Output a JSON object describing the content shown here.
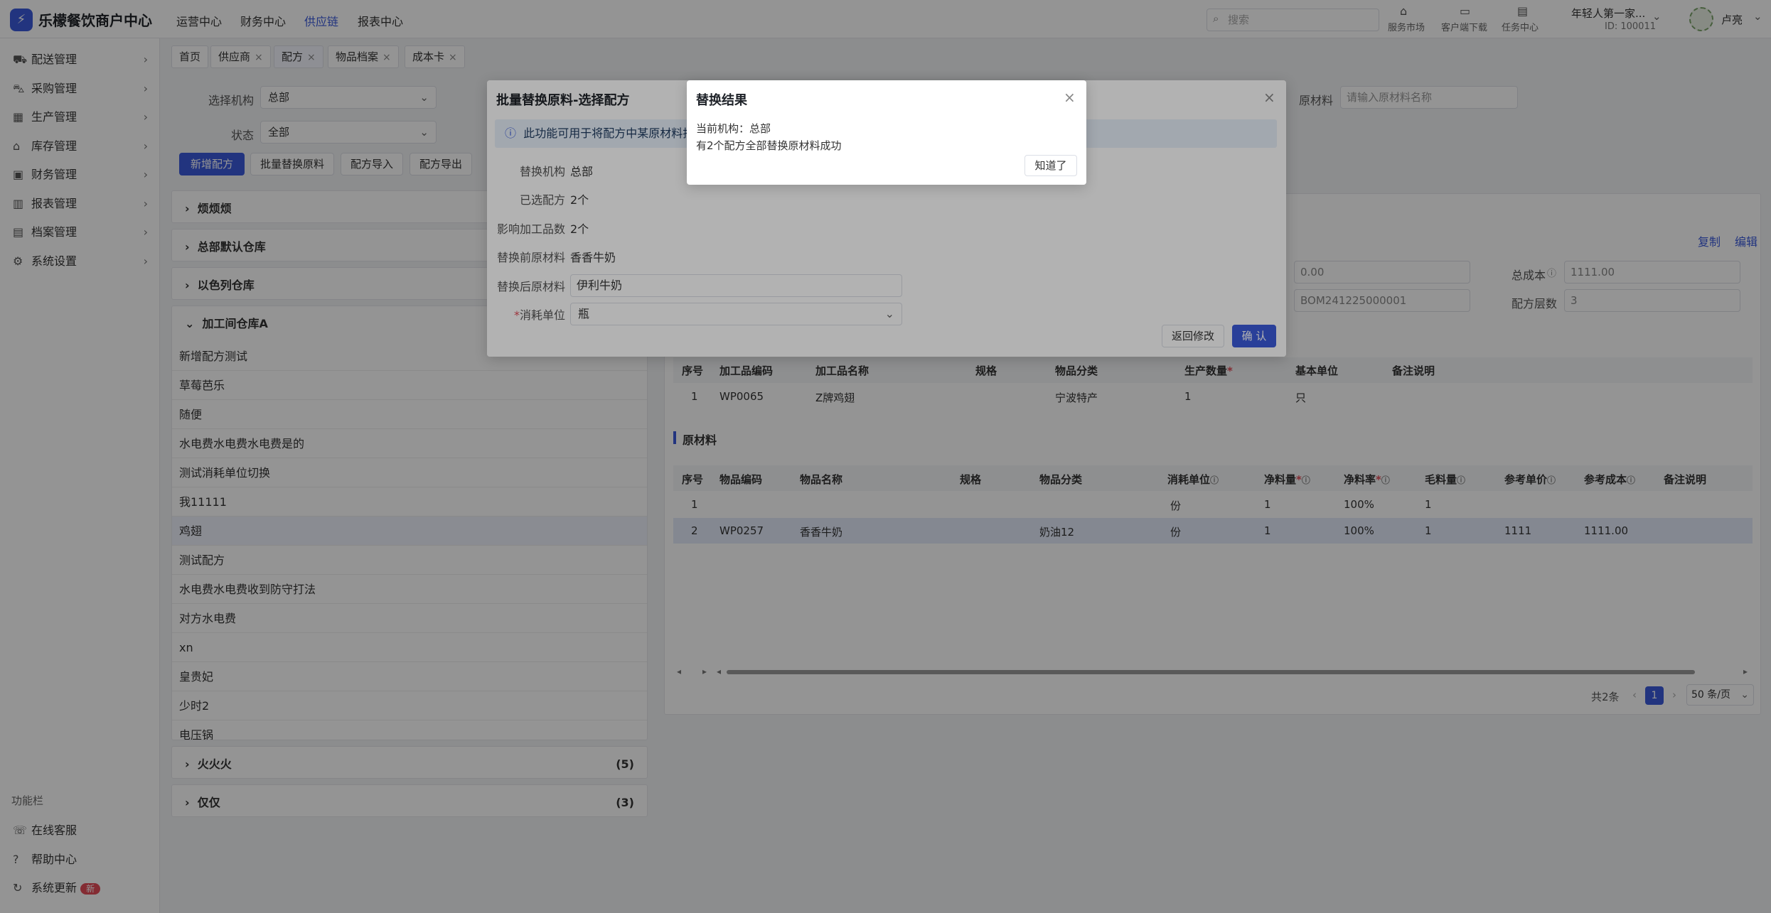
{
  "header": {
    "app_name": "乐檬餐饮商户中心",
    "logo_glyph": "⚡",
    "nav": [
      "运营中心",
      "财务中心",
      "供应链",
      "报表中心"
    ],
    "active_nav": "供应链",
    "search_placeholder": "搜索",
    "tools": [
      "服务市场",
      "客户端下载",
      "任务中心"
    ],
    "user_name": "年轻人第一家...",
    "user_id": "ID: 100011",
    "account_name": "卢亮"
  },
  "sidebar": {
    "items": [
      "配送管理",
      "采购管理",
      "生产管理",
      "库存管理",
      "财务管理",
      "报表管理",
      "档案管理",
      "系统设置"
    ],
    "bottom_title": "功能栏",
    "bottom_items": [
      "在线客服",
      "帮助中心",
      "系统更新"
    ],
    "new_badge": "新"
  },
  "tabs": [
    {
      "label": "首页",
      "closable": false
    },
    {
      "label": "供应商",
      "closable": true
    },
    {
      "label": "配方",
      "closable": true
    },
    {
      "label": "物品档案",
      "closable": true
    },
    {
      "label": "成本卡",
      "closable": true
    }
  ],
  "filters": {
    "org_label": "选择机构",
    "org_value": "总部",
    "status_label": "状态",
    "status_value": "全部",
    "material_label": "原材料",
    "material_placeholder": "请输入原材料名称"
  },
  "actions": [
    "新增配方",
    "批量替换原料",
    "配方导入",
    "配方导出"
  ],
  "groups_top": [
    "烦烦烦",
    "总部默认仓库",
    "以色列仓库",
    "加工间仓库A"
  ],
  "list_items": [
    "新增配方测试",
    "草莓芭乐",
    "随便",
    "水电费水电费水电费是的",
    "测试消耗单位切换",
    "我11111",
    "鸡翅",
    "测试配方",
    "水电费水电费收到防守打法",
    "对方水电费",
    "xn",
    "皇贵妃",
    "少时2",
    "电压锅"
  ],
  "groups_bottom": [
    {
      "name": "火火火",
      "count": "(5)"
    },
    {
      "name": "仅仅",
      "count": "(3)"
    }
  ],
  "detail": {
    "copy": "复制",
    "edit": "编辑",
    "field1_value": "0.00",
    "total_cost_label": "总成本",
    "total_cost_value": "1111.00",
    "bom_code": "BOM241225000001",
    "level_label": "配方层数",
    "level_value": "3",
    "product_headers": [
      "序号",
      "加工品编码",
      "加工品名称",
      "规格",
      "物品分类",
      "生产数量",
      "基本单位",
      "备注说明"
    ],
    "product_rows": [
      [
        "1",
        "WP0065",
        "Z牌鸡翅",
        "",
        "宁波特产",
        "1",
        "只",
        ""
      ]
    ],
    "raw_title": "原材料",
    "raw_headers": [
      "序号",
      "物品编码",
      "物品名称",
      "规格",
      "物品分类",
      "消耗单位",
      "净料量",
      "净料率",
      "毛料量",
      "参考单价",
      "参考成本",
      "备注说明"
    ],
    "raw_rows": [
      [
        "1",
        "",
        "",
        "",
        "",
        "份",
        "1",
        "100%",
        "1",
        "",
        "",
        ""
      ],
      [
        "2",
        "WP0257",
        "香香牛奶",
        "",
        "奶油12",
        "份",
        "1",
        "100%",
        "1",
        "1111",
        "1111.00",
        ""
      ]
    ],
    "total_text": "共2条",
    "current_page": "1",
    "page_size": "50 条/页"
  },
  "modal": {
    "title": "批量替换原料-选择配方",
    "info": "此功能可用于将配方中某原材料批",
    "rows": [
      {
        "label": "替换机构",
        "value": "总部"
      },
      {
        "label": "已选配方",
        "value": "2个"
      },
      {
        "label": "影响加工品数",
        "value": "2个"
      },
      {
        "label": "替换前原材料",
        "value": "香香牛奶"
      }
    ],
    "after_label": "替换后原材料",
    "after_value": "伊利牛奶",
    "unit_label": "消耗单位",
    "unit_value": "瓶",
    "back_button": "返回修改",
    "confirm_button": "确 认"
  },
  "result": {
    "title": "替换结果",
    "org_line": "当前机构：总部",
    "message": "有2个配方全部替换原材料成功",
    "ok_button": "知道了"
  }
}
